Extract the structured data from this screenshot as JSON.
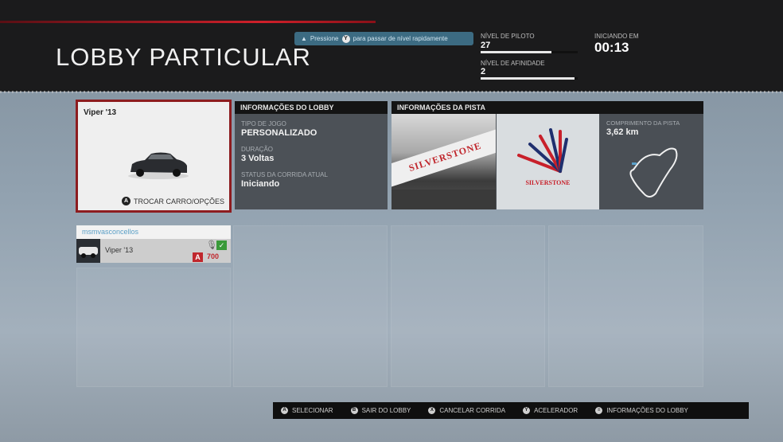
{
  "header": {
    "title": "LOBBY PARTICULAR",
    "hint": {
      "before": "Pressione",
      "button": "Y",
      "after": "para passar de nível rapidamente"
    },
    "pilot_level": {
      "label": "NÍVEL DE PILOTO",
      "value": "27",
      "progress": 0.73
    },
    "affinity_level": {
      "label": "NÍVEL DE AFINIDADE",
      "value": "2",
      "progress": 0.97
    },
    "countdown": {
      "label": "INICIANDO EM",
      "value": "00:13"
    }
  },
  "car_card": {
    "name": "Viper '13",
    "button": "A",
    "action": "TROCAR CARRO/OPÇÕES"
  },
  "lobby_info": {
    "title": "INFORMAÇÕES DO LOBBY",
    "fields": [
      {
        "label": "TIPO DE JOGO",
        "value": "PERSONALIZADO"
      },
      {
        "label": "DURAÇÃO",
        "value": "3 Voltas"
      },
      {
        "label": "STATUS DA CORRIDA ATUAL",
        "value": "Iniciando"
      }
    ]
  },
  "track_info": {
    "title": "INFORMAÇÕES DA PISTA",
    "photo_sign": "SILVERSTONE",
    "logo_text": "SILVERSTONE",
    "length_label": "COMPRIMENTO DA PISTA",
    "length_value": "3,62 km"
  },
  "player": {
    "gamertag": "msmvasconcellos",
    "car": "Viper '13",
    "class": "A",
    "rating": "700"
  },
  "footer": [
    {
      "button": "A",
      "label": "SELECIONAR"
    },
    {
      "button": "B",
      "label": "SAIR DO LOBBY"
    },
    {
      "button": "X",
      "label": "CANCELAR CORRIDA"
    },
    {
      "button": "Y",
      "label": "ACELERADOR"
    },
    {
      "button": "≡",
      "label": "INFORMAÇÕES DO LOBBY"
    }
  ],
  "colors": {
    "accent_red": "#8d1c1f",
    "hint_bg": "#3c6b82",
    "gamertag": "#5a9fc6"
  }
}
